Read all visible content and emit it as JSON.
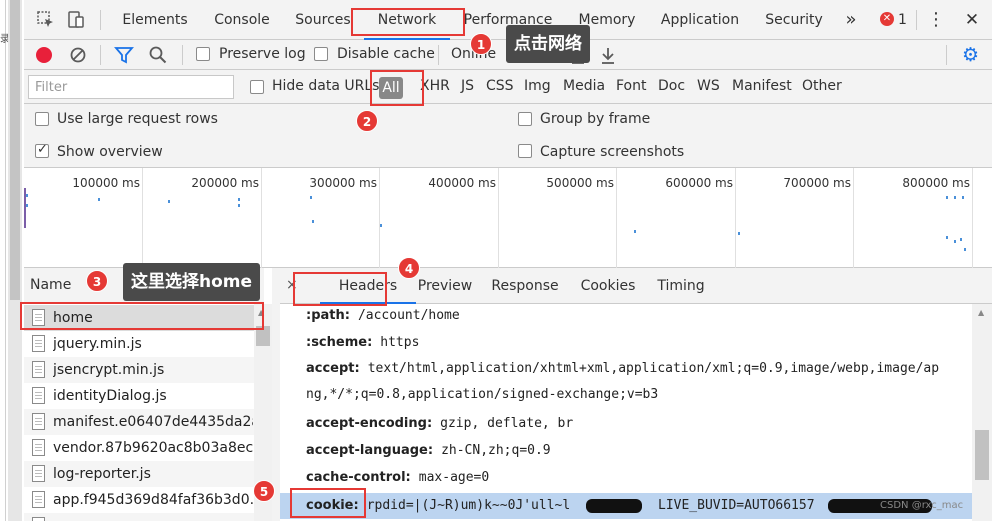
{
  "tabbar": {
    "tabs": [
      "Elements",
      "Console",
      "Sources",
      "Network",
      "Performance",
      "Memory",
      "Application",
      "Security"
    ],
    "more": "»",
    "error_count": "1",
    "kebab": "⋮",
    "close": "✕"
  },
  "toolbar": {
    "preserve_log": "Preserve log",
    "disable_cache": "Disable cache",
    "online": "Online"
  },
  "filter": {
    "placeholder": "Filter",
    "hide_data_urls": "Hide data URLs",
    "types": [
      "All",
      "XHR",
      "JS",
      "CSS",
      "Img",
      "Media",
      "Font",
      "Doc",
      "WS",
      "Manifest",
      "Other"
    ]
  },
  "options": {
    "large_rows": "Use large request rows",
    "show_overview": "Show overview",
    "group_by_frame": "Group by frame",
    "capture_screenshots": "Capture screenshots"
  },
  "overview": {
    "ticks": [
      "100000 ms",
      "200000 ms",
      "300000 ms",
      "400000 ms",
      "500000 ms",
      "600000 ms",
      "700000 ms",
      "800000 ms"
    ]
  },
  "requests": {
    "header": "Name",
    "items": [
      "home",
      "jquery.min.js",
      "jsencrypt.min.js",
      "identityDialog.js",
      "manifest.e06407de4435da2a6",
      "vendor.87b9620ac8b03a8ec24",
      "log-reporter.js",
      "app.f945d369d84faf36b3d0.js",
      "~~"
    ]
  },
  "detail": {
    "tabs": [
      "Headers",
      "Preview",
      "Response",
      "Cookies",
      "Timing"
    ],
    "close": "×",
    "headers": [
      {
        "name": ":path:",
        "value": "/account/home"
      },
      {
        "name": ":scheme:",
        "value": "https"
      },
      {
        "name": "accept:",
        "value": "text/html,application/xhtml+xml,application/xml;q=0.9,image/webp,image/ap ng,*/*;q=0.8,application/signed-exchange;v=b3"
      },
      {
        "name": "accept-encoding:",
        "value": "gzip, deflate, br"
      },
      {
        "name": "accept-language:",
        "value": "zh-CN,zh;q=0.9"
      },
      {
        "name": "cache-control:",
        "value": "max-age=0"
      },
      {
        "name": "cookie:",
        "value": "rpdid=|(J~R)um)k~~0J'ull~l"
      }
    ],
    "cookie_more": "LIVE_BUVID=AUTO66157"
  },
  "annotations": {
    "n1": "1",
    "tip1": "点击网络",
    "n2": "2",
    "n3": "3",
    "tip3": "这里选择home",
    "n4": "4",
    "n5": "5"
  },
  "watermark": "CSDN @rxc_mac"
}
